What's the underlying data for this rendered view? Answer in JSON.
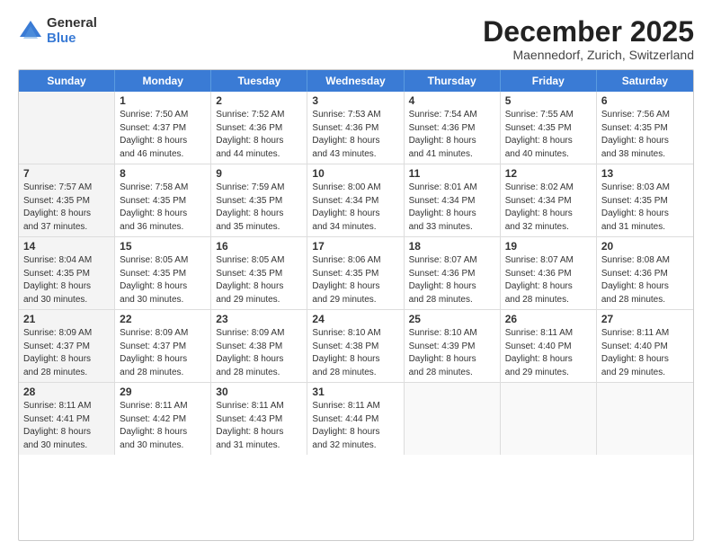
{
  "logo": {
    "general": "General",
    "blue": "Blue"
  },
  "header": {
    "month": "December 2025",
    "location": "Maennedorf, Zurich, Switzerland"
  },
  "weekdays": [
    "Sunday",
    "Monday",
    "Tuesday",
    "Wednesday",
    "Thursday",
    "Friday",
    "Saturday"
  ],
  "weeks": [
    [
      {
        "day": "",
        "info": "",
        "shaded": true
      },
      {
        "day": "1",
        "info": "Sunrise: 7:50 AM\nSunset: 4:37 PM\nDaylight: 8 hours\nand 46 minutes."
      },
      {
        "day": "2",
        "info": "Sunrise: 7:52 AM\nSunset: 4:36 PM\nDaylight: 8 hours\nand 44 minutes."
      },
      {
        "day": "3",
        "info": "Sunrise: 7:53 AM\nSunset: 4:36 PM\nDaylight: 8 hours\nand 43 minutes."
      },
      {
        "day": "4",
        "info": "Sunrise: 7:54 AM\nSunset: 4:36 PM\nDaylight: 8 hours\nand 41 minutes."
      },
      {
        "day": "5",
        "info": "Sunrise: 7:55 AM\nSunset: 4:35 PM\nDaylight: 8 hours\nand 40 minutes."
      },
      {
        "day": "6",
        "info": "Sunrise: 7:56 AM\nSunset: 4:35 PM\nDaylight: 8 hours\nand 38 minutes."
      }
    ],
    [
      {
        "day": "7",
        "info": "Sunrise: 7:57 AM\nSunset: 4:35 PM\nDaylight: 8 hours\nand 37 minutes.",
        "shaded": true
      },
      {
        "day": "8",
        "info": "Sunrise: 7:58 AM\nSunset: 4:35 PM\nDaylight: 8 hours\nand 36 minutes."
      },
      {
        "day": "9",
        "info": "Sunrise: 7:59 AM\nSunset: 4:35 PM\nDaylight: 8 hours\nand 35 minutes."
      },
      {
        "day": "10",
        "info": "Sunrise: 8:00 AM\nSunset: 4:34 PM\nDaylight: 8 hours\nand 34 minutes."
      },
      {
        "day": "11",
        "info": "Sunrise: 8:01 AM\nSunset: 4:34 PM\nDaylight: 8 hours\nand 33 minutes."
      },
      {
        "day": "12",
        "info": "Sunrise: 8:02 AM\nSunset: 4:34 PM\nDaylight: 8 hours\nand 32 minutes."
      },
      {
        "day": "13",
        "info": "Sunrise: 8:03 AM\nSunset: 4:35 PM\nDaylight: 8 hours\nand 31 minutes."
      }
    ],
    [
      {
        "day": "14",
        "info": "Sunrise: 8:04 AM\nSunset: 4:35 PM\nDaylight: 8 hours\nand 30 minutes.",
        "shaded": true
      },
      {
        "day": "15",
        "info": "Sunrise: 8:05 AM\nSunset: 4:35 PM\nDaylight: 8 hours\nand 30 minutes."
      },
      {
        "day": "16",
        "info": "Sunrise: 8:05 AM\nSunset: 4:35 PM\nDaylight: 8 hours\nand 29 minutes."
      },
      {
        "day": "17",
        "info": "Sunrise: 8:06 AM\nSunset: 4:35 PM\nDaylight: 8 hours\nand 29 minutes."
      },
      {
        "day": "18",
        "info": "Sunrise: 8:07 AM\nSunset: 4:36 PM\nDaylight: 8 hours\nand 28 minutes."
      },
      {
        "day": "19",
        "info": "Sunrise: 8:07 AM\nSunset: 4:36 PM\nDaylight: 8 hours\nand 28 minutes."
      },
      {
        "day": "20",
        "info": "Sunrise: 8:08 AM\nSunset: 4:36 PM\nDaylight: 8 hours\nand 28 minutes."
      }
    ],
    [
      {
        "day": "21",
        "info": "Sunrise: 8:09 AM\nSunset: 4:37 PM\nDaylight: 8 hours\nand 28 minutes.",
        "shaded": true
      },
      {
        "day": "22",
        "info": "Sunrise: 8:09 AM\nSunset: 4:37 PM\nDaylight: 8 hours\nand 28 minutes."
      },
      {
        "day": "23",
        "info": "Sunrise: 8:09 AM\nSunset: 4:38 PM\nDaylight: 8 hours\nand 28 minutes."
      },
      {
        "day": "24",
        "info": "Sunrise: 8:10 AM\nSunset: 4:38 PM\nDaylight: 8 hours\nand 28 minutes."
      },
      {
        "day": "25",
        "info": "Sunrise: 8:10 AM\nSunset: 4:39 PM\nDaylight: 8 hours\nand 28 minutes."
      },
      {
        "day": "26",
        "info": "Sunrise: 8:11 AM\nSunset: 4:40 PM\nDaylight: 8 hours\nand 29 minutes."
      },
      {
        "day": "27",
        "info": "Sunrise: 8:11 AM\nSunset: 4:40 PM\nDaylight: 8 hours\nand 29 minutes."
      }
    ],
    [
      {
        "day": "28",
        "info": "Sunrise: 8:11 AM\nSunset: 4:41 PM\nDaylight: 8 hours\nand 30 minutes.",
        "shaded": true
      },
      {
        "day": "29",
        "info": "Sunrise: 8:11 AM\nSunset: 4:42 PM\nDaylight: 8 hours\nand 30 minutes."
      },
      {
        "day": "30",
        "info": "Sunrise: 8:11 AM\nSunset: 4:43 PM\nDaylight: 8 hours\nand 31 minutes."
      },
      {
        "day": "31",
        "info": "Sunrise: 8:11 AM\nSunset: 4:44 PM\nDaylight: 8 hours\nand 32 minutes."
      },
      {
        "day": "",
        "info": "",
        "empty": true
      },
      {
        "day": "",
        "info": "",
        "empty": true
      },
      {
        "day": "",
        "info": "",
        "empty": true
      }
    ]
  ]
}
